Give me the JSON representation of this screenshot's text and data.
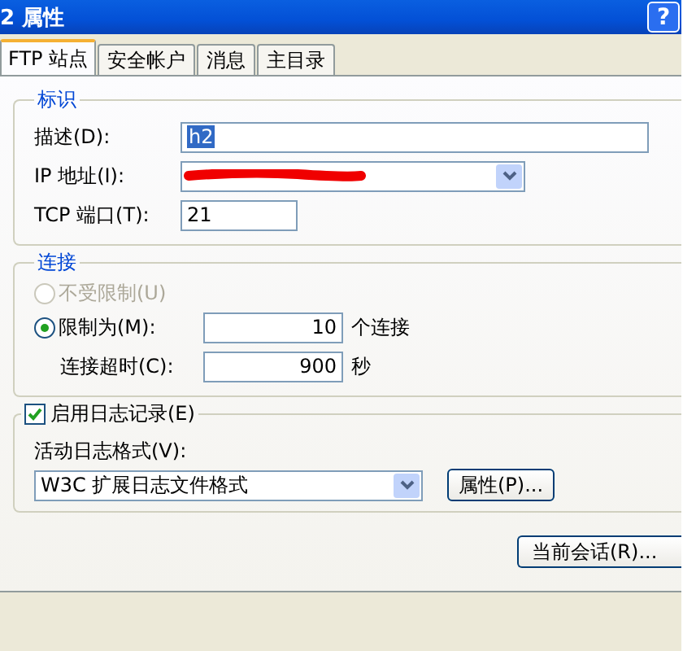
{
  "window": {
    "title": "2 属性",
    "help_button": "?"
  },
  "tabs": [
    {
      "label": "FTP 站点",
      "selected": true
    },
    {
      "label": "安全帐户",
      "selected": false
    },
    {
      "label": "消息",
      "selected": false
    },
    {
      "label": "主目录",
      "selected": false
    }
  ],
  "identification": {
    "title": "标识",
    "description": {
      "label": "描述(D):",
      "value": "h2"
    },
    "ip_address": {
      "label": "IP 地址(I):"
    },
    "tcp_port": {
      "label": "TCP 端口(T):",
      "value": "21"
    }
  },
  "connections": {
    "title": "连接",
    "options": [
      {
        "label": "不受限制(U)",
        "selected": false,
        "disabled": true
      },
      {
        "label": "限制为(M):",
        "selected": true,
        "disabled": false,
        "value": "10",
        "unit": "个连接"
      }
    ],
    "timeout": {
      "label": "连接超时(C):",
      "value": "900",
      "unit": "秒"
    }
  },
  "logging": {
    "label": "启用日志记录(E)",
    "checked": true,
    "format_label": "活动日志格式(V):",
    "format": "W3C 扩展日志文件格式",
    "properties_button": "属性(P)..."
  },
  "current_sessions_button": "当前会话(R)..."
}
